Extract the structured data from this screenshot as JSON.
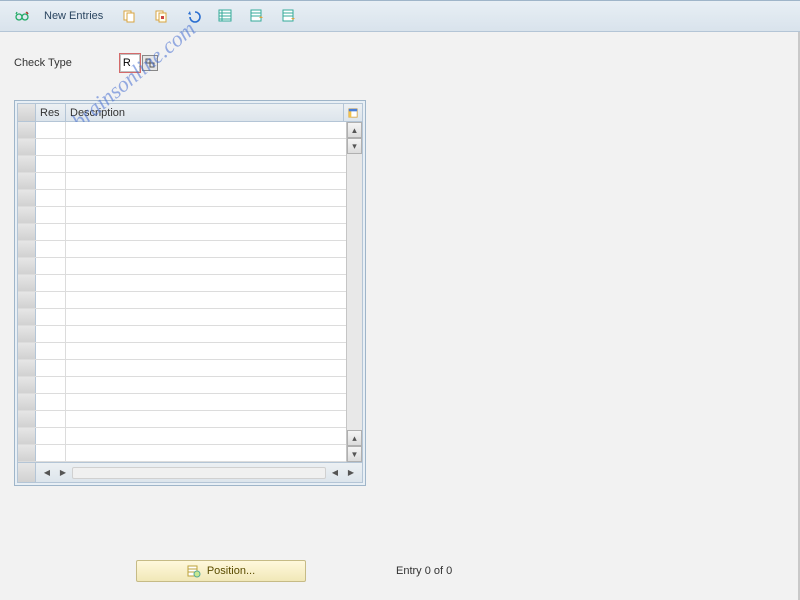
{
  "toolbar": {
    "new_entries_label": "New Entries"
  },
  "form": {
    "check_type_label": "Check Type",
    "check_type_value": "R"
  },
  "table": {
    "headers": {
      "res": "Res",
      "description": "Description"
    },
    "row_count": 20
  },
  "footer": {
    "position_label": "Position...",
    "entry_text": "Entry 0 of 0"
  },
  "watermark": "sapbrainsonline.com"
}
